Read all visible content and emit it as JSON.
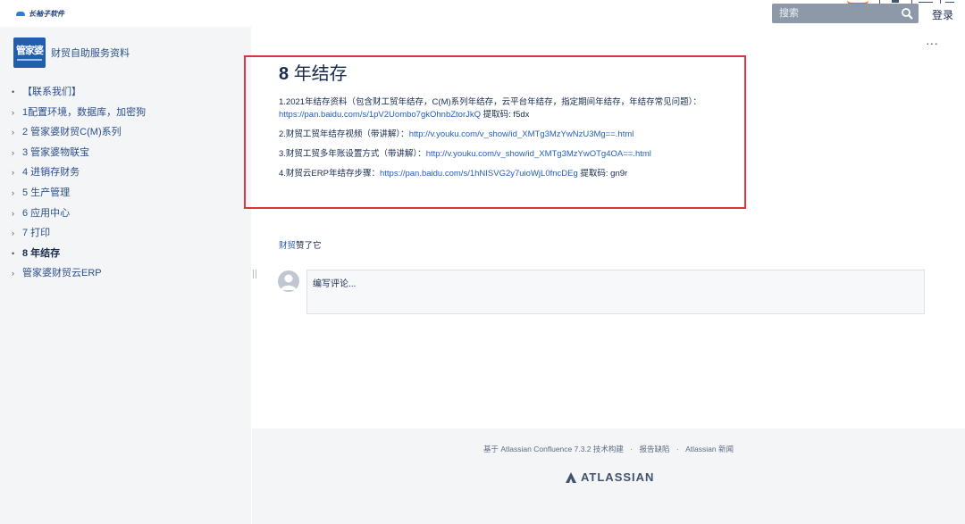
{
  "header": {
    "brand_text": "长袖子软件",
    "search_placeholder": "搜索",
    "login_label": "登录"
  },
  "sidebar": {
    "space_logo_text": "管家婆",
    "space_name": "财贸自助服务资料",
    "items": [
      {
        "marker": "•",
        "label": "【联系我们】",
        "active": false
      },
      {
        "marker": "›",
        "label": "1配置环境，数据库，加密狗",
        "active": false
      },
      {
        "marker": "›",
        "label": "2 管家婆财贸C(M)系列",
        "active": false
      },
      {
        "marker": "›",
        "label": "3 管家婆物联宝",
        "active": false
      },
      {
        "marker": "›",
        "label": "4 进销存财务",
        "active": false
      },
      {
        "marker": "›",
        "label": "5 生产管理",
        "active": false
      },
      {
        "marker": "›",
        "label": "6 应用中心",
        "active": false
      },
      {
        "marker": "›",
        "label": "7 打印",
        "active": false
      },
      {
        "marker": "•",
        "label": "8 年结存",
        "active": true
      },
      {
        "marker": "›",
        "label": "管家婆财贸云ERP",
        "active": false
      }
    ]
  },
  "page": {
    "more_label": "···",
    "title_number": "8",
    "title_text": "年结存",
    "paragraphs": [
      {
        "text": "1.2021年结存资料（包含财工贸年结存，C(M)系列年结存，云平台年结存，指定期间年结存，年结存常见问题）：",
        "link": "https://pan.baidu.com/s/1pV2Uombo7gkOhnbZtorJkQ",
        "after": " 提取码: f5dx"
      },
      {
        "text": "2.财贸工贸年结存视频（带讲解）：",
        "link": "http://v.youku.com/v_show/id_XMTg3MzYwNzU3Mg==.html",
        "after": ""
      },
      {
        "text": "3.财贸工贸多年账设置方式（带讲解）：",
        "link": "http://v.youku.com/v_show/id_XMTg3MzYwOTg4OA==.html",
        "after": ""
      },
      {
        "text": "4.财贸云ERP年结存步骤：",
        "link": "https://pan.baidu.com/s/1hNISVG2y7uioWjL0fncDEg",
        "after": " 提取码: gn9r"
      }
    ],
    "likes_user": "财贸",
    "likes_text": "赞了它",
    "comment_placeholder": "编写评论..."
  },
  "footer": {
    "powered_by": "基于 Atlassian Confluence 7.3.2 技术构建",
    "report_bug": "报告缺陷",
    "news": "Atlassian 新闻",
    "atlassian_logo": "ATLASSIAN"
  },
  "colors": {
    "highlight_border": "#d9363e",
    "link": "#2460b8",
    "search_bg": "#8d99a8"
  }
}
